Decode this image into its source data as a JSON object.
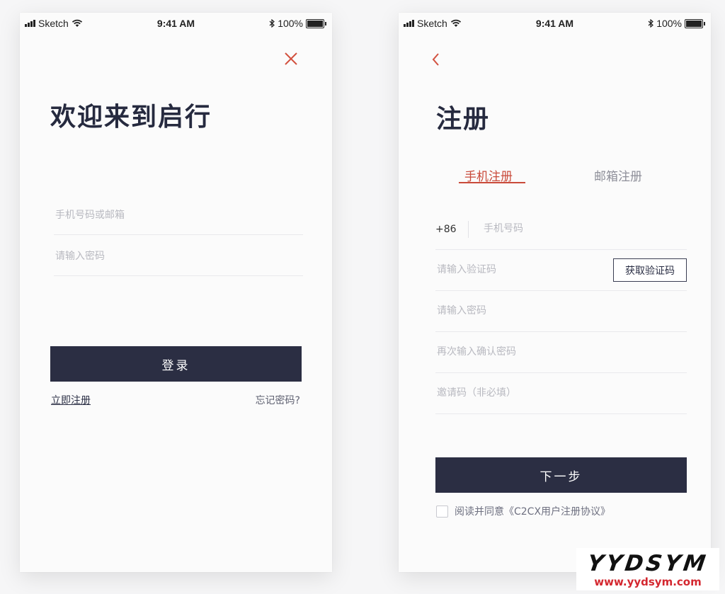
{
  "status_bar": {
    "carrier": "Sketch",
    "time": "9:41 AM",
    "battery": "100%"
  },
  "login": {
    "title": "欢迎来到启行",
    "account_placeholder": "手机号码或邮箱",
    "password_placeholder": "请输入密码",
    "login_label": "登录",
    "register_link": "立即注册",
    "forgot_link": "忘记密码?"
  },
  "register": {
    "title": "注册",
    "tabs": [
      {
        "label": "手机注册",
        "active": true
      },
      {
        "label": "邮箱注册",
        "active": false
      }
    ],
    "country_code": "+86",
    "phone_placeholder": "手机号码",
    "code_placeholder": "请输入验证码",
    "get_code_label": "获取验证码",
    "password_placeholder": "请输入密码",
    "confirm_placeholder": "再次输入确认密码",
    "invite_placeholder": "邀请码（非必填）",
    "next_label": "下一步",
    "agreement_text": "阅读并同意《C2CX用户注册协议》",
    "agreement_checked": false
  },
  "watermark": {
    "name": "YYDSYM",
    "url": "www.yydsym.com"
  },
  "colors": {
    "accent": "#c94a3a",
    "button_dark": "#2b2e43",
    "background": "#f6f6f7",
    "watermark_url": "#d4272f"
  },
  "icons": {
    "close": "close-icon",
    "back": "chevron-left-icon",
    "wifi": "wifi-icon",
    "bluetooth": "bluetooth-icon",
    "battery": "battery-icon",
    "signal": "signal-icon"
  }
}
